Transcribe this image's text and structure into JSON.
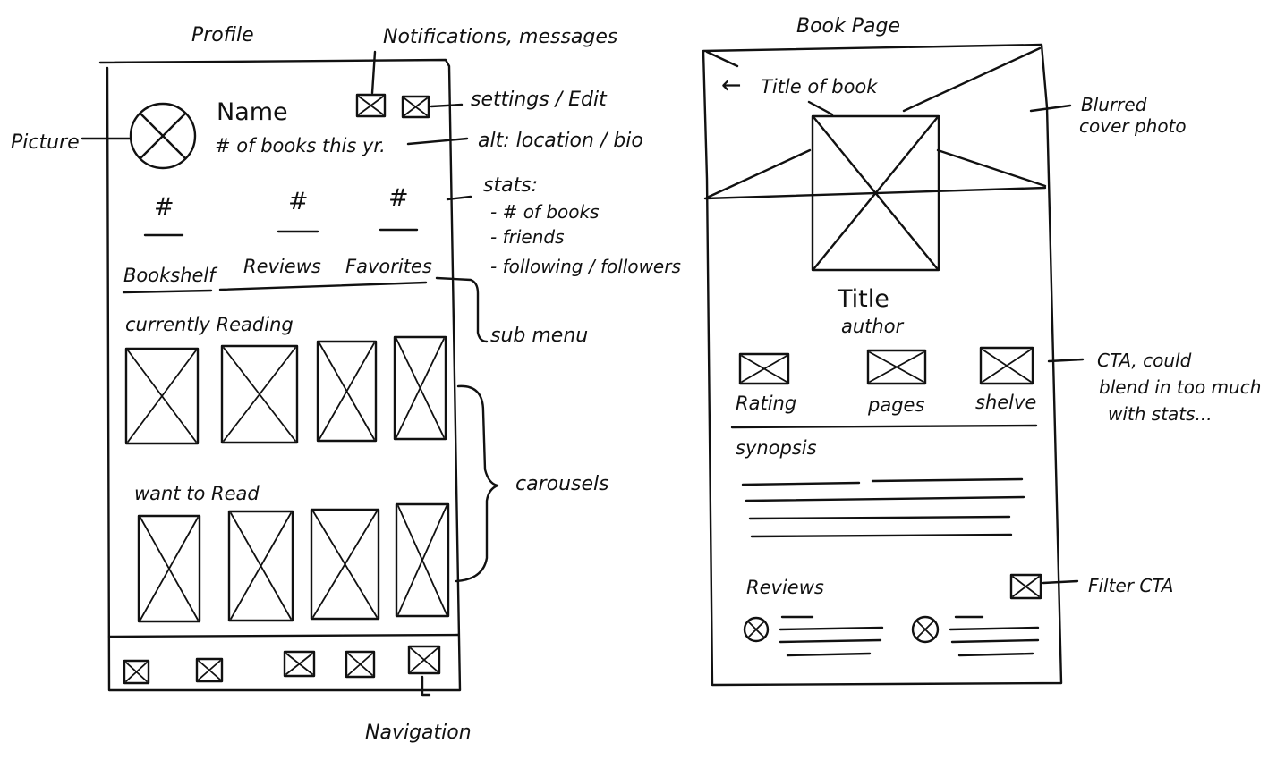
{
  "profile_sketch": {
    "heading": "Profile",
    "name": "Name",
    "books_this_year": "# of books this yr.",
    "stats": [
      "#",
      "#",
      "#"
    ],
    "tabs": [
      "Bookshelf",
      "Reviews",
      "Favorites"
    ],
    "section_currently": "currently Reading",
    "section_want": "want to Read",
    "annotations": {
      "picture": "Picture",
      "notifications": "Notifications, messages",
      "settings": "settings / Edit",
      "alt": "alt: location / bio",
      "stats_title": "stats:",
      "stats_items": [
        "- # of books",
        "- friends",
        "- following / followers"
      ],
      "submenu": "sub menu",
      "carousels": "carousels",
      "navigation": "Navigation"
    }
  },
  "book_sketch": {
    "heading": "Book Page",
    "back": "←",
    "title_of_book": "Title of book",
    "title": "Title",
    "author": "author",
    "stat_labels": [
      "Rating",
      "pages",
      "shelve"
    ],
    "synopsis": "synopsis",
    "reviews": "Reviews",
    "annotations": {
      "blurred_line1": "Blurred",
      "blurred_line2": "cover photo",
      "cta_line1": "CTA, could",
      "cta_line2": "blend in too much",
      "cta_line3": "with stats...",
      "filter": "Filter CTA"
    }
  }
}
